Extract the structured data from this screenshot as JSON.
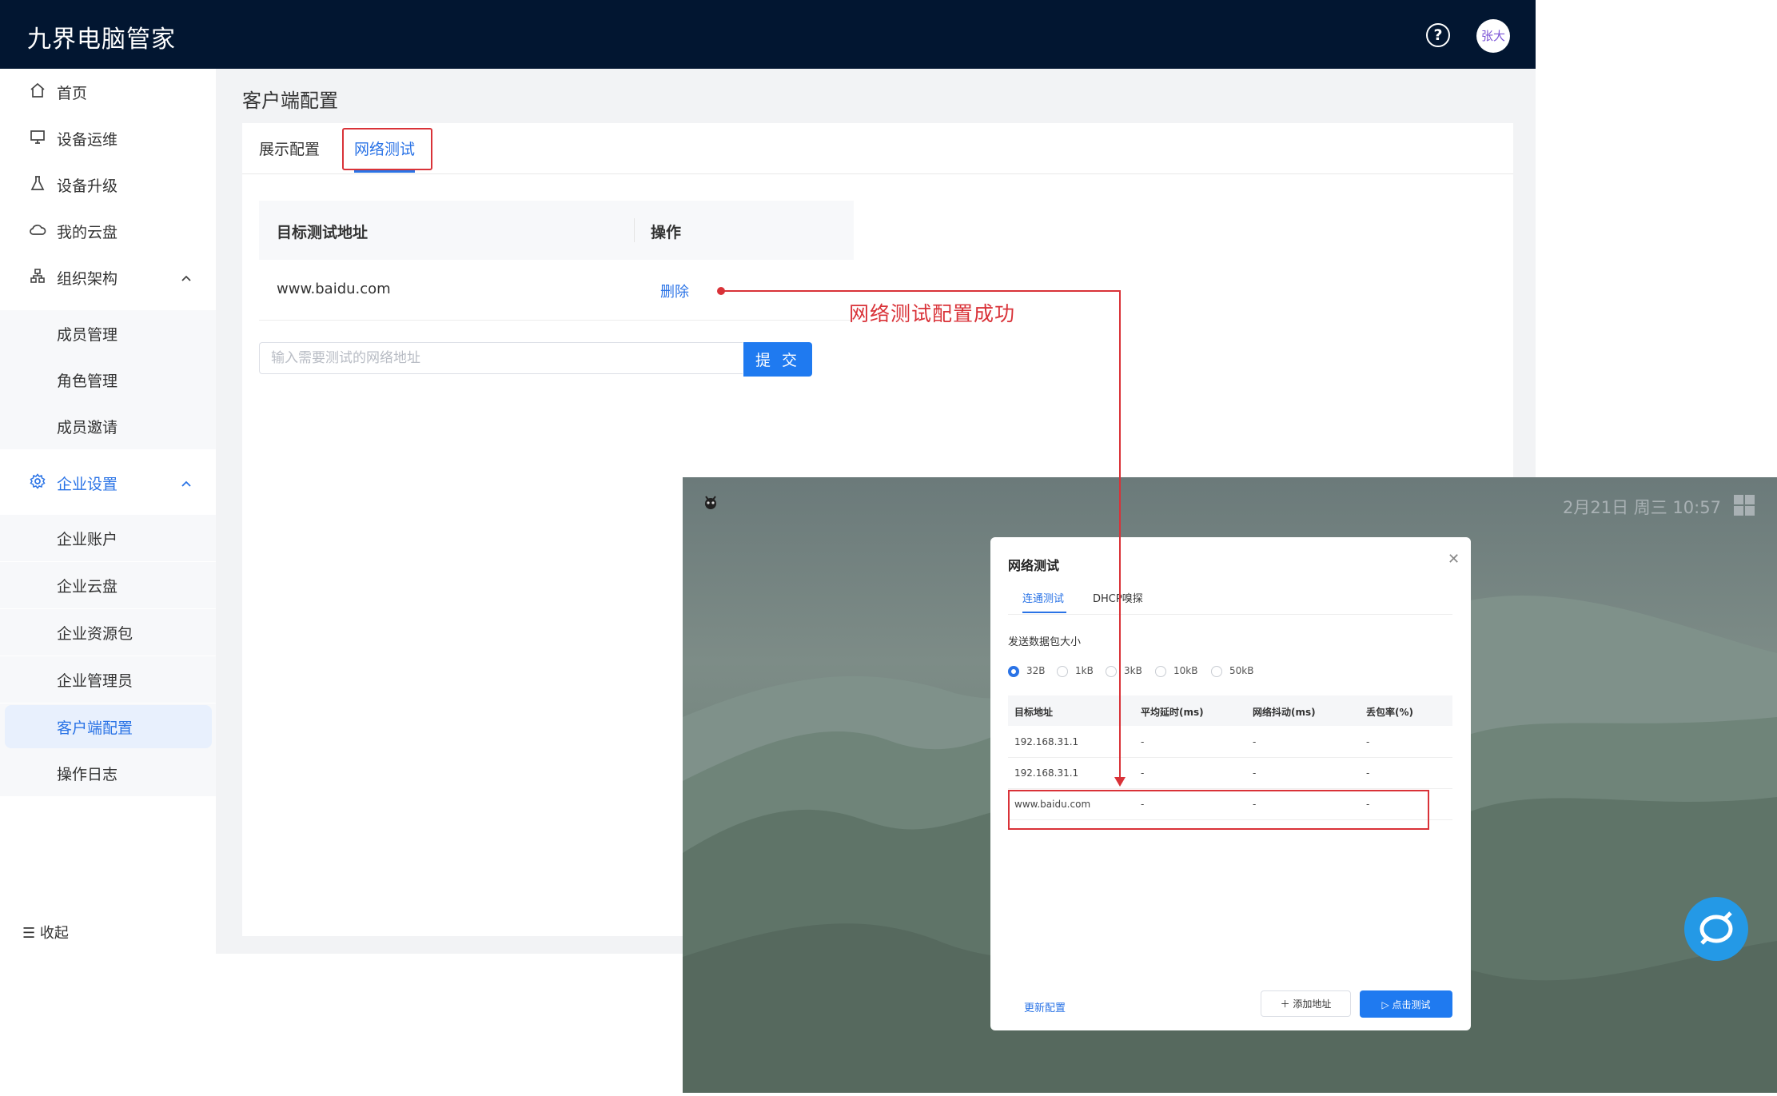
{
  "header": {
    "brand": "九界电脑管家",
    "avatar_text": "张大",
    "help_icon": "help-circle-icon"
  },
  "sidebar": {
    "items": [
      {
        "label": "首页",
        "icon": "home-icon"
      },
      {
        "label": "设备运维",
        "icon": "monitor-icon"
      },
      {
        "label": "设备升级",
        "icon": "flask-icon"
      },
      {
        "label": "我的云盘",
        "icon": "cloud-icon"
      },
      {
        "label": "组织架构",
        "icon": "org-chart-icon",
        "expanded": true,
        "children": [
          "成员管理",
          "角色管理",
          "成员邀请"
        ]
      },
      {
        "label": "企业设置",
        "icon": "gear-icon",
        "expanded": true,
        "active": true,
        "children": [
          "企业账户",
          "企业云盘",
          "企业资源包",
          "企业管理员",
          "客户端配置",
          "操作日志"
        ],
        "selected_child": "客户端配置"
      }
    ],
    "collapse_label": "收起"
  },
  "main": {
    "page_title": "客户端配置",
    "tabs": [
      {
        "label": "展示配置",
        "active": false
      },
      {
        "label": "网络测试",
        "active": true
      }
    ],
    "table": {
      "headers": [
        "目标测试地址",
        "操作"
      ],
      "rows": [
        {
          "address": "www.baidu.com",
          "action": "删除"
        }
      ]
    },
    "input_placeholder": "输入需要测试的网络地址",
    "submit_label": "提 交"
  },
  "annotation": {
    "text": "网络测试配置成功",
    "color": "#d93238"
  },
  "desktop": {
    "clock": "2月21日 周三 10:57",
    "dialog": {
      "title": "网络测试",
      "tabs": [
        {
          "label": "连通测试",
          "active": true
        },
        {
          "label": "DHCP嗅探",
          "active": false
        }
      ],
      "size_label": "发送数据包大小",
      "size_options": [
        "32B",
        "1kB",
        "3kB",
        "10kB",
        "50kB"
      ],
      "size_selected": "32B",
      "columns": [
        "目标地址",
        "平均延时(ms)",
        "网络抖动(ms)",
        "丢包率(%)"
      ],
      "rows": [
        [
          "192.168.31.1",
          "-",
          "-",
          "-"
        ],
        [
          "192.168.31.1",
          "-",
          "-",
          "-"
        ],
        [
          "www.baidu.com",
          "-",
          "-",
          "-"
        ]
      ],
      "update_link": "更新配置",
      "add_button": "添加地址",
      "test_button": "点击测试"
    }
  },
  "colors": {
    "topbar": "#021631",
    "accent": "#2a73e6",
    "annotation": "#d93238"
  }
}
